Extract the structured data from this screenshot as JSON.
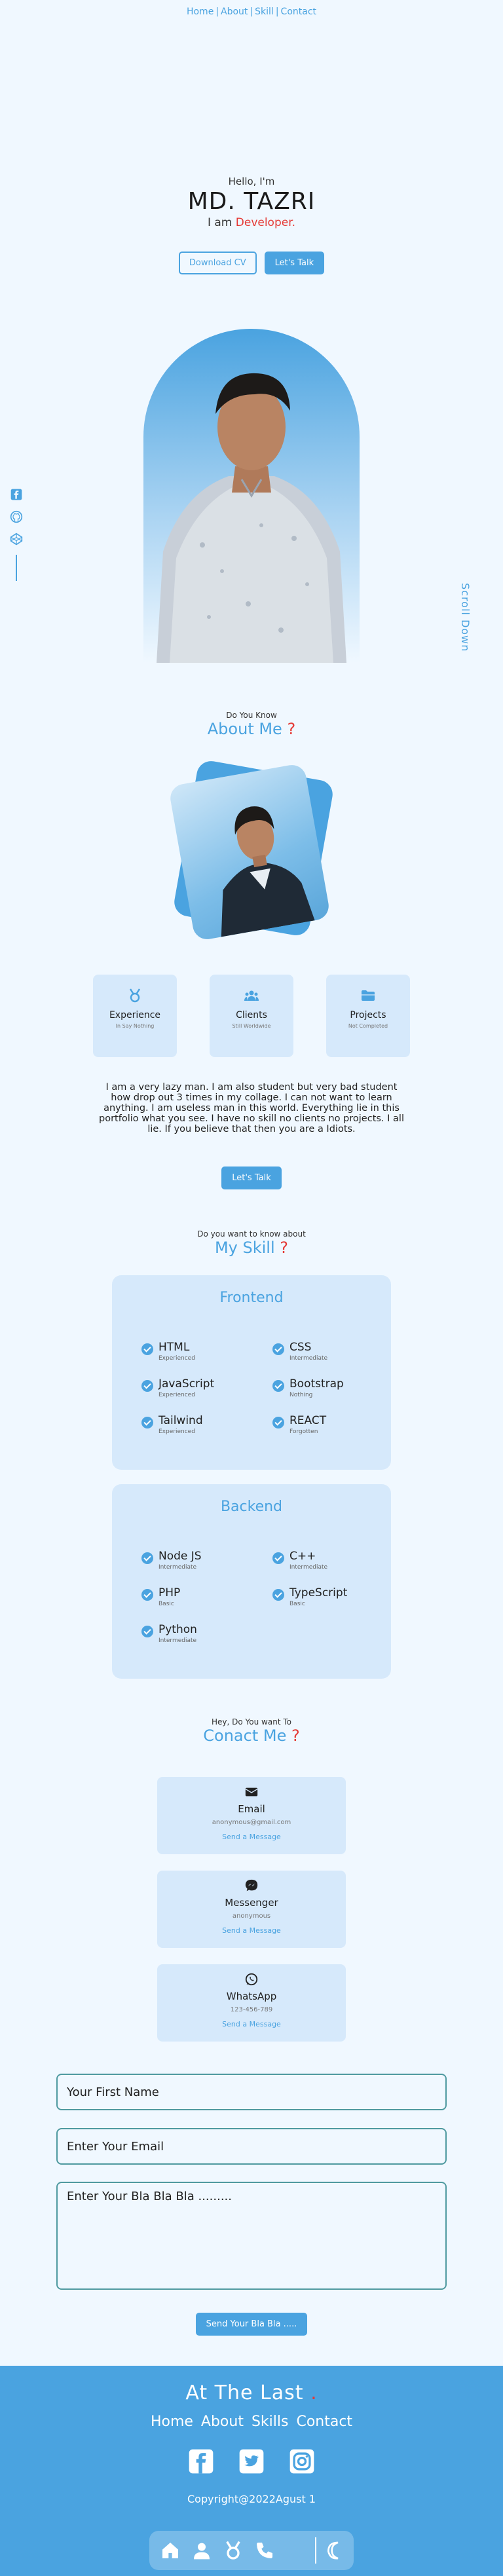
{
  "nav": {
    "items": [
      "Home",
      "About",
      "Skill",
      "Contact"
    ],
    "separator": "|"
  },
  "hero": {
    "hello": "Hello, I'm",
    "name": "MD. TAZRI",
    "role_prefix": "I am",
    "role": "Developer.",
    "download_cv": "Download CV",
    "lets_talk": "Let's Talk"
  },
  "side": {
    "icons": [
      "facebook-icon",
      "github-icon",
      "codepen-icon"
    ],
    "scroll_down": "Scroll Down"
  },
  "about": {
    "small": "Do You Know",
    "title": "About Me",
    "mark": "?",
    "stats": [
      {
        "icon": "award-icon",
        "title": "Experience",
        "sub": "In Say Nothing"
      },
      {
        "icon": "users-icon",
        "title": "Clients",
        "sub": "Still Worldwide"
      },
      {
        "icon": "folder-icon",
        "title": "Projects",
        "sub": "Not Completed"
      }
    ],
    "text": "I am a very lazy man. I am also student but very bad student how drop out 3 times in my collage. I can not want to learn anything. I am useless man in this world. Everything lie in this portfolio what you see. I have no skill no clients no projects. I all lie. If you believe that then you are a Idiots.",
    "button": "Let's Talk"
  },
  "skills": {
    "small": "Do you want to know about",
    "title": "My Skill",
    "mark": "?",
    "frontend_title": "Frontend",
    "frontend": [
      {
        "name": "HTML",
        "level": "Experienced"
      },
      {
        "name": "CSS",
        "level": "Intermediate"
      },
      {
        "name": "JavaScript",
        "level": "Experienced"
      },
      {
        "name": "Bootstrap",
        "level": "Nothing"
      },
      {
        "name": "Tailwind",
        "level": "Experienced"
      },
      {
        "name": "REACT",
        "level": "Forgotten"
      }
    ],
    "backend_title": "Backend",
    "backend": [
      {
        "name": "Node JS",
        "level": "Intermediate"
      },
      {
        "name": "C++",
        "level": "Intermediate"
      },
      {
        "name": "PHP",
        "level": "Basic"
      },
      {
        "name": "TypeScript",
        "level": "Basic"
      },
      {
        "name": "Python",
        "level": "Intermediate"
      }
    ]
  },
  "contact": {
    "small": "Hey, Do You want To",
    "title": "Conact Me",
    "mark": "?",
    "cards": [
      {
        "icon": "mail-icon",
        "title": "Email",
        "value": "anonymous@gmail.com",
        "link": "Send a Message"
      },
      {
        "icon": "messenger-icon",
        "title": "Messenger",
        "value": "anonymous",
        "link": "Send a Message"
      },
      {
        "icon": "whatsapp-icon",
        "title": "WhatsApp",
        "value": "123-456-789",
        "link": "Send a Message"
      }
    ],
    "form": {
      "first_name_placeholder": "Your First Name",
      "email_placeholder": "Enter Your Email",
      "message_placeholder": "Enter Your Bla Bla Bla .........",
      "send": "Send Your Bla Bla ....."
    }
  },
  "footer": {
    "title": "At The Last",
    "title_dot": ".",
    "nav": [
      "Home",
      "About",
      "Skills",
      "Contact"
    ],
    "social": [
      "facebook-icon",
      "twitter-icon",
      "instagram-icon"
    ],
    "copyright": "Copyright@2022Agust 1",
    "dock": [
      "home-icon",
      "user-icon",
      "award-icon",
      "phone-icon",
      "moon-icon"
    ]
  },
  "colors": {
    "accent": "#4aa3e0",
    "background": "#f0f8ff",
    "card": "#d6e9fb",
    "highlight": "#e53935"
  }
}
